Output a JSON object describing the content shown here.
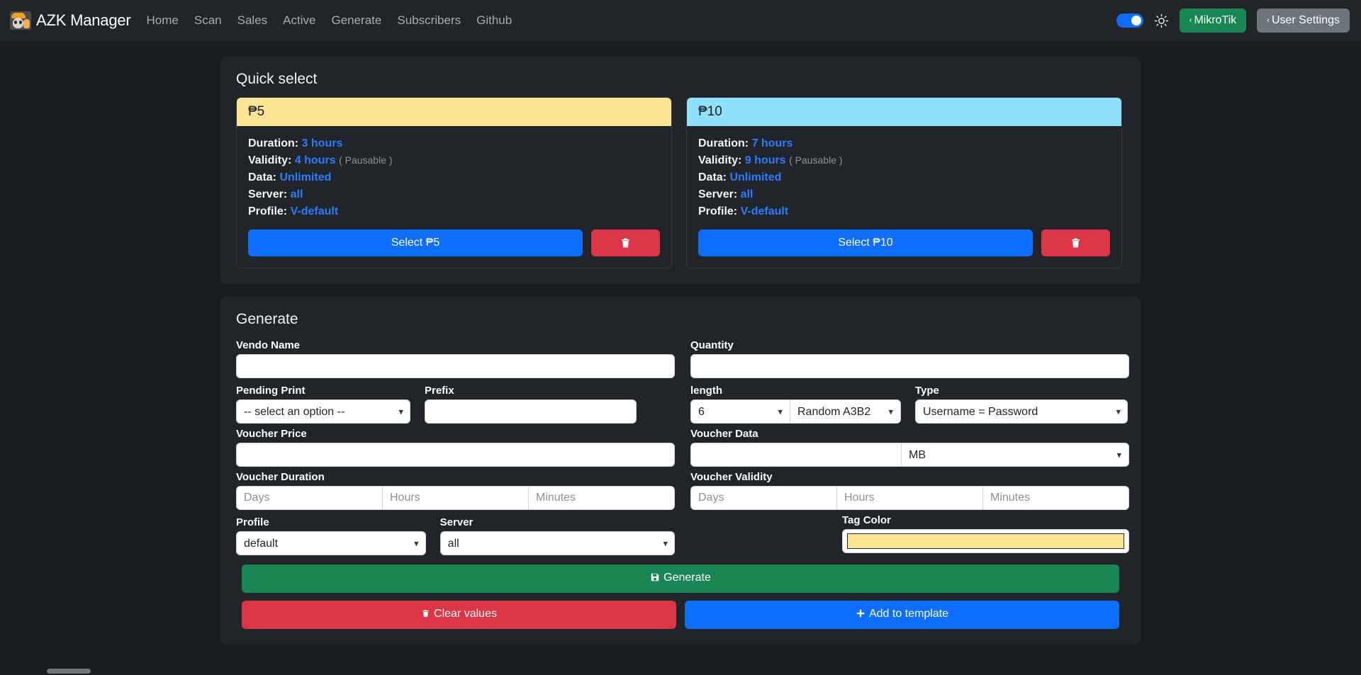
{
  "brand": {
    "name": "AZK Manager",
    "logo_icon": "avatar-logo-icon"
  },
  "nav": {
    "links": [
      {
        "label": "Home"
      },
      {
        "label": "Scan"
      },
      {
        "label": "Sales"
      },
      {
        "label": "Active"
      },
      {
        "label": "Generate"
      },
      {
        "label": "Subscribers"
      },
      {
        "label": "Github"
      }
    ],
    "theme_toggle": {
      "state": "on",
      "accent": "#0d6efd"
    },
    "sun_icon": "sun-icon",
    "mikrotik_button": {
      "label": "MikroTik",
      "caret": "‹",
      "color": "#198754"
    },
    "user_settings_button": {
      "label": "User Settings",
      "caret": "‹",
      "color": "#6c757d"
    }
  },
  "quick_select": {
    "title": "Quick select",
    "cards": [
      {
        "price": "₱5",
        "header_color": "#fbe493",
        "duration_label": "Duration:",
        "duration_value": "3 hours",
        "validity_label": "Validity:",
        "validity_value": "4 hours",
        "validity_note": "( Pausable )",
        "data_label": "Data:",
        "data_value": "Unlimited",
        "server_label": "Server:",
        "server_value": "all",
        "profile_label": "Profile:",
        "profile_value": "V-default",
        "select_label": "Select ₱5",
        "delete_icon": "trash-icon"
      },
      {
        "price": "₱10",
        "header_color": "#90e0fb",
        "duration_label": "Duration:",
        "duration_value": "7 hours",
        "validity_label": "Validity:",
        "validity_value": "9 hours",
        "validity_note": "( Pausable )",
        "data_label": "Data:",
        "data_value": "Unlimited",
        "server_label": "Server:",
        "server_value": "all",
        "profile_label": "Profile:",
        "profile_value": "V-default",
        "select_label": "Select ₱10",
        "delete_icon": "trash-icon"
      }
    ]
  },
  "generate": {
    "title": "Generate",
    "vendo_name": {
      "label": "Vendo Name",
      "value": "",
      "placeholder": ""
    },
    "quantity": {
      "label": "Quantity",
      "value": "",
      "placeholder": ""
    },
    "pending_print": {
      "label": "Pending Print",
      "value": "-- select an option --"
    },
    "prefix": {
      "label": "Prefix",
      "value": "",
      "placeholder": ""
    },
    "length": {
      "label": "length",
      "value": "6",
      "mode_value": "Random A3B2"
    },
    "type": {
      "label": "Type",
      "value": "Username = Password"
    },
    "voucher_price": {
      "label": "Voucher Price",
      "value": "",
      "placeholder": ""
    },
    "voucher_data": {
      "label": "Voucher Data",
      "value": "",
      "placeholder": "",
      "unit_value": "MB"
    },
    "voucher_duration": {
      "label": "Voucher Duration",
      "days_placeholder": "Days",
      "hours_placeholder": "Hours",
      "minutes_placeholder": "Minutes",
      "days_value": "",
      "hours_value": "",
      "minutes_value": ""
    },
    "voucher_validity": {
      "label": "Voucher Validity",
      "days_placeholder": "Days",
      "hours_placeholder": "Hours",
      "minutes_placeholder": "Minutes",
      "days_value": "",
      "hours_value": "",
      "minutes_value": ""
    },
    "profile": {
      "label": "Profile",
      "value": "default"
    },
    "server": {
      "label": "Server",
      "value": "all"
    },
    "tag_color": {
      "label": "Tag Color",
      "value": "#fbe493"
    },
    "generate_button": {
      "label": "Generate",
      "icon": "save-icon",
      "color": "#198754"
    },
    "clear_button": {
      "label": "Clear values",
      "icon": "trash-icon",
      "color": "#dc3545"
    },
    "add_template_button": {
      "label": "Add to template",
      "icon": "plus-icon",
      "color": "#0d6efd"
    }
  }
}
